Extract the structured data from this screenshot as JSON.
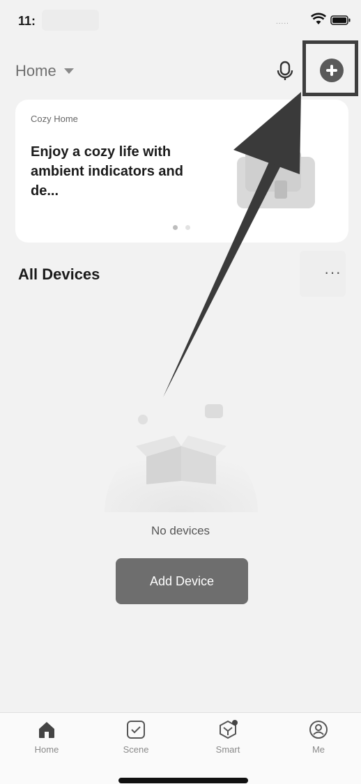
{
  "status_bar": {
    "time": "11:",
    "signal": "....."
  },
  "header": {
    "title": "Home"
  },
  "banner": {
    "label": "Cozy Home",
    "text": "Enjoy a cozy life with ambient indicators and de...",
    "pages": 2,
    "active_page": 1
  },
  "section": {
    "title": "All Devices",
    "more_glyph": "···"
  },
  "empty_state": {
    "message": "No devices",
    "button_label": "Add Device"
  },
  "tabs": [
    {
      "label": "Home",
      "icon": "home-icon",
      "active": true
    },
    {
      "label": "Scene",
      "icon": "scene-checkbox-icon",
      "active": false
    },
    {
      "label": "Smart",
      "icon": "smart-icon",
      "active": false
    },
    {
      "label": "Me",
      "icon": "profile-icon",
      "active": false
    }
  ],
  "colors": {
    "background": "#f2f2f2",
    "card": "#ffffff",
    "button": "#6e6e6e",
    "highlight_box": "#3e3e3e"
  }
}
